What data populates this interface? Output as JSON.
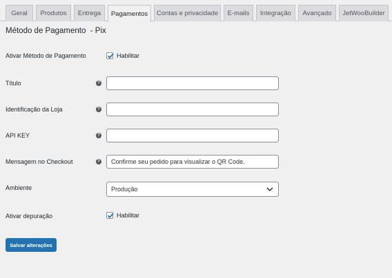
{
  "tabs": [
    {
      "label": "Geral"
    },
    {
      "label": "Produtos"
    },
    {
      "label": "Entrega"
    },
    {
      "label": "Pagamentos"
    },
    {
      "label": "Contas e privacidade"
    },
    {
      "label": "E-mails"
    },
    {
      "label": "Integração"
    },
    {
      "label": "Avançado"
    },
    {
      "label": "JetWooBuilder"
    }
  ],
  "active_tab": "Pagamentos",
  "page": {
    "title": "Método de Pagamento  - Pix"
  },
  "fields": {
    "enable": {
      "label": "Ativar Método de Pagamento",
      "checkbox_label": "Habilitar",
      "checked": true
    },
    "title": {
      "label": "Título",
      "value": ""
    },
    "store_id": {
      "label": "Identificação da Loja",
      "value": ""
    },
    "api_key": {
      "label": "API KEY",
      "value": ""
    },
    "checkout_message": {
      "label": "Mensagem no Checkout",
      "value": "Confirme seu pedido para visualizar o QR Code."
    },
    "environment": {
      "label": "Ambiente",
      "selected": "Produção"
    },
    "debug": {
      "label": "Ativar depuração",
      "checkbox_label": "Habilitar",
      "checked": true
    }
  },
  "help_icon_glyph": "?",
  "save_button": {
    "label": "Salvar alterações"
  },
  "colors": {
    "accent": "#2271b1",
    "background": "#f0f0f1"
  }
}
